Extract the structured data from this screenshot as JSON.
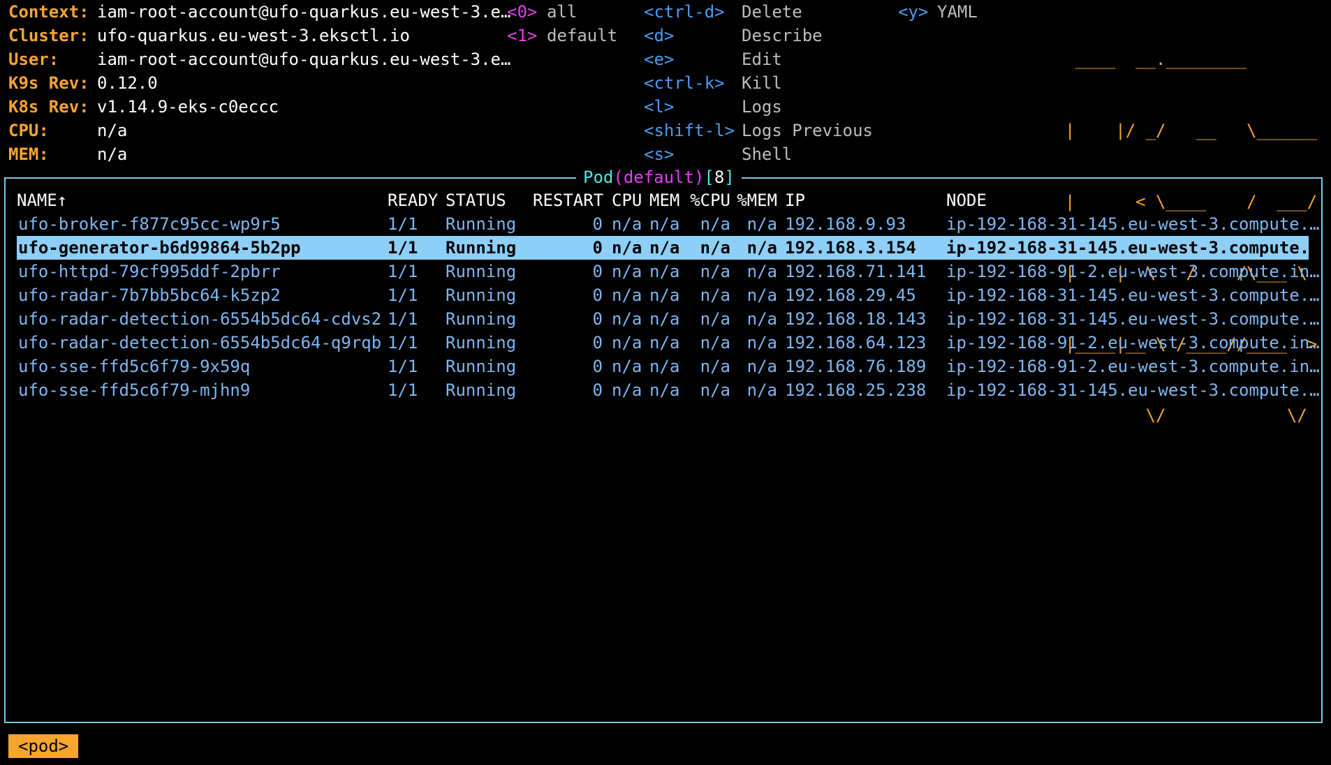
{
  "header": {
    "info": [
      {
        "label": "Context:",
        "value": "iam-root-account@ufo-quarkus.eu-west-3.e…"
      },
      {
        "label": "Cluster:",
        "value": "ufo-quarkus.eu-west-3.eksctl.io"
      },
      {
        "label": "User:",
        "value": "iam-root-account@ufo-quarkus.eu-west-3.e…"
      },
      {
        "label": "K9s Rev:",
        "value": "0.12.0"
      },
      {
        "label": "K8s Rev:",
        "value": "v1.14.9-eks-c0eccc"
      },
      {
        "label": "CPU:",
        "value": "n/a"
      },
      {
        "label": "MEM:",
        "value": "n/a"
      }
    ],
    "namespaces": [
      {
        "key": "<0>",
        "name": "all"
      },
      {
        "key": "<1>",
        "name": "default"
      }
    ],
    "hotkeys": [
      {
        "key": "<ctrl-d>",
        "desc": "Delete"
      },
      {
        "key": "<d>",
        "desc": "Describe"
      },
      {
        "key": "<e>",
        "desc": "Edit"
      },
      {
        "key": "<ctrl-k>",
        "desc": "Kill"
      },
      {
        "key": "<l>",
        "desc": "Logs"
      },
      {
        "key": "<shift-l>",
        "desc": "Logs Previous"
      },
      {
        "key": "<s>",
        "desc": "Shell"
      }
    ],
    "hotkeys2": [
      {
        "key": "<y>",
        "desc": "YAML"
      }
    ],
    "logo": [
      " ____  __.________       ",
      "|    |/ _/   __   \\______",
      "|      < \\____    /  ___/",
      "|    |  \\   /    /\\___ \\ ",
      "|____|__ \\ /____//____  >",
      "        \\/            \\/ "
    ]
  },
  "panel": {
    "resource": "Pod",
    "namespace": "default",
    "count": "8"
  },
  "table": {
    "columns": [
      "NAME↑",
      "READY",
      "STATUS",
      "RESTART",
      "CPU",
      "MEM",
      "%CPU",
      "%MEM",
      "IP",
      "NODE"
    ],
    "rows": [
      [
        "ufo-broker-f877c95cc-wp9r5",
        "1/1",
        "Running",
        "0",
        "n/a",
        "n/a",
        "n/a",
        "n/a",
        "192.168.9.93",
        "ip-192-168-31-145.eu-west-3.compute.…"
      ],
      [
        "ufo-generator-b6d99864-5b2pp",
        "1/1",
        "Running",
        "0",
        "n/a",
        "n/a",
        "n/a",
        "n/a",
        "192.168.3.154",
        "ip-192-168-31-145.eu-west-3.compute.…"
      ],
      [
        "ufo-httpd-79cf995ddf-2pbrr",
        "1/1",
        "Running",
        "0",
        "n/a",
        "n/a",
        "n/a",
        "n/a",
        "192.168.71.141",
        "ip-192-168-91-2.eu-west-3.compute.in…"
      ],
      [
        "ufo-radar-7b7bb5bc64-k5zp2",
        "1/1",
        "Running",
        "0",
        "n/a",
        "n/a",
        "n/a",
        "n/a",
        "192.168.29.45",
        "ip-192-168-31-145.eu-west-3.compute.…"
      ],
      [
        "ufo-radar-detection-6554b5dc64-cdvs2",
        "1/1",
        "Running",
        "0",
        "n/a",
        "n/a",
        "n/a",
        "n/a",
        "192.168.18.143",
        "ip-192-168-31-145.eu-west-3.compute.…"
      ],
      [
        "ufo-radar-detection-6554b5dc64-q9rqb",
        "1/1",
        "Running",
        "0",
        "n/a",
        "n/a",
        "n/a",
        "n/a",
        "192.168.64.123",
        "ip-192-168-91-2.eu-west-3.compute.in…"
      ],
      [
        "ufo-sse-ffd5c6f79-9x59q",
        "1/1",
        "Running",
        "0",
        "n/a",
        "n/a",
        "n/a",
        "n/a",
        "192.168.76.189",
        "ip-192-168-91-2.eu-west-3.compute.in…"
      ],
      [
        "ufo-sse-ffd5c6f79-mjhn9",
        "1/1",
        "Running",
        "0",
        "n/a",
        "n/a",
        "n/a",
        "n/a",
        "192.168.25.238",
        "ip-192-168-31-145.eu-west-3.compute.…"
      ]
    ],
    "selected_row": 1
  },
  "footer": {
    "crumb": "<pod>"
  }
}
